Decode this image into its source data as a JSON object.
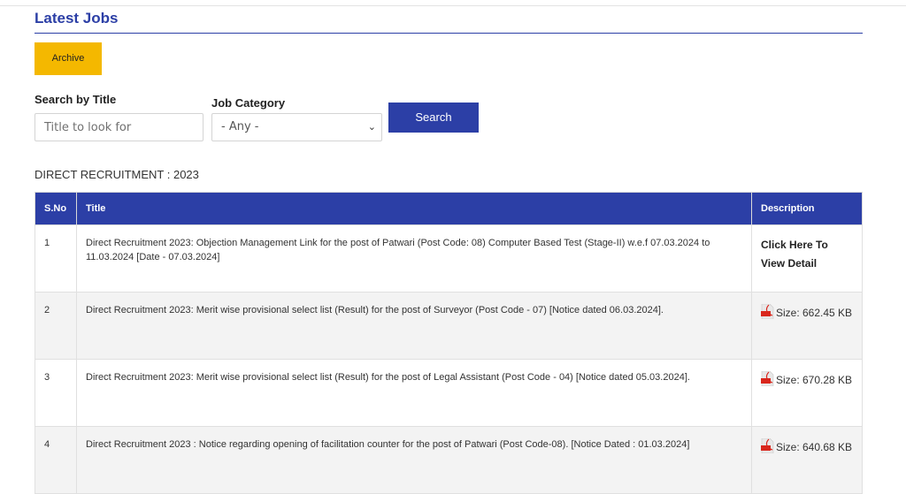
{
  "page": {
    "title": "Latest Jobs"
  },
  "actions": {
    "archive_label": "Archive",
    "search_label": "Search"
  },
  "search": {
    "title_label": "Search by Title",
    "title_placeholder": "Title to look for",
    "category_label": "Job Category",
    "category_selected": "- Any -"
  },
  "section": {
    "heading": "DIRECT RECRUITMENT : 2023"
  },
  "table": {
    "headers": {
      "sno": "S.No",
      "title": "Title",
      "description": "Description"
    },
    "rows": [
      {
        "sno": "1",
        "title": "Direct Recruitment 2023: Objection Management Link for the post of Patwari (Post Code: 08) Computer Based Test (Stage-II) w.e.f 07.03.2024 to 11.03.2024 [Date - 07.03.2024]",
        "desc_type": "link",
        "description": "Click Here To View Detail"
      },
      {
        "sno": "2",
        "title": "Direct Recruitment 2023: Merit wise provisional select list (Result) for the post of Surveyor (Post Code - 07) [Notice dated 06.03.2024].",
        "desc_type": "pdf",
        "description": "Size: 662.45 KB"
      },
      {
        "sno": "3",
        "title": "Direct Recruitment 2023: Merit wise provisional select list (Result) for the post of Legal Assistant (Post Code - 04) [Notice dated 05.03.2024].",
        "desc_type": "pdf",
        "description": "Size: 670.28 KB"
      },
      {
        "sno": "4",
        "title": "Direct Recruitment 2023 : Notice regarding opening of facilitation counter for the post of Patwari (Post Code-08). [Notice Dated : 01.03.2024]",
        "desc_type": "pdf",
        "description": "Size: 640.68 KB"
      }
    ]
  },
  "icons": {
    "pdf": "pdf-file-icon",
    "select_arrow": "chevron-down-icon"
  },
  "colors": {
    "brand_blue": "#2c3fa6",
    "archive_yellow": "#f4b800"
  }
}
